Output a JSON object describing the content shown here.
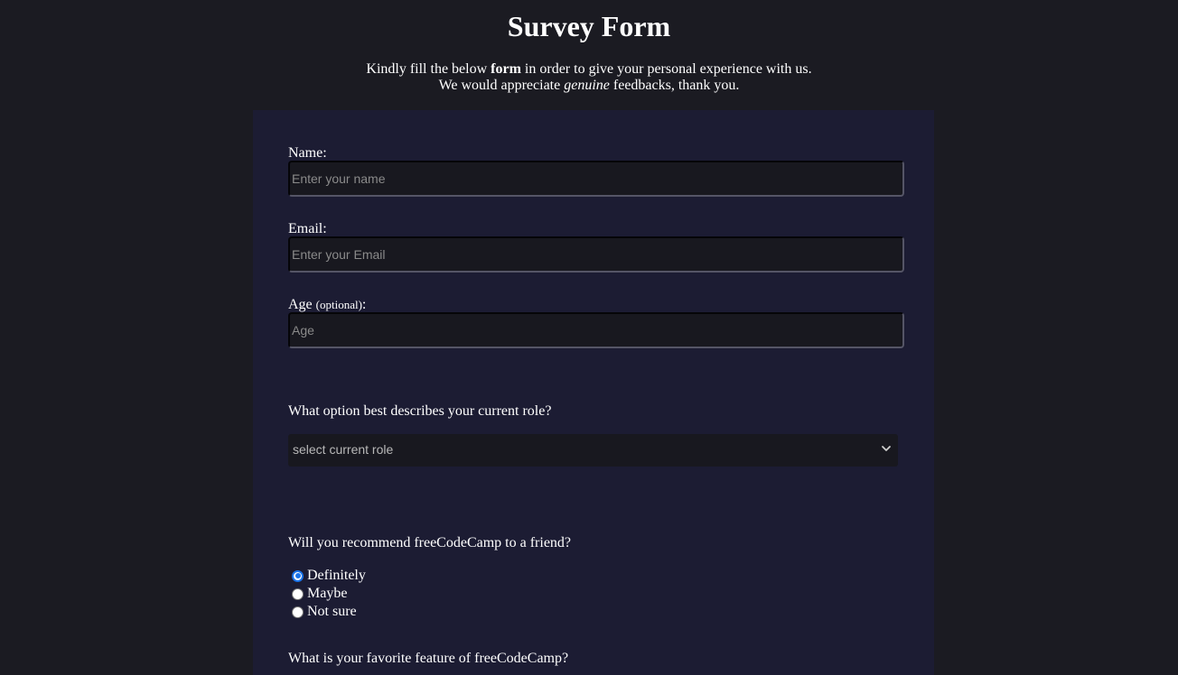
{
  "header": {
    "title": "Survey Form",
    "intro_line1_a": "Kindly fill the below ",
    "intro_line1_bold": "form",
    "intro_line1_b": " in order to give your personal experience with us.",
    "intro_line2_a": "We would appreciate ",
    "intro_line2_italic": "genuine",
    "intro_line2_b": " feedbacks, thank you."
  },
  "form": {
    "name": {
      "label": "Name:",
      "placeholder": "Enter your name",
      "value": ""
    },
    "email": {
      "label": "Email:",
      "placeholder": "Enter your Email",
      "value": ""
    },
    "age": {
      "label": "Age",
      "label_note": "(optional)",
      "label_suffix": ":",
      "placeholder": "Age",
      "value": ""
    },
    "role": {
      "question": "What option best describes your current role?",
      "selected": "select current role"
    },
    "recommend": {
      "question": "Will you recommend freeCodeCamp to a friend?",
      "options": [
        {
          "label": "Definitely",
          "checked": true
        },
        {
          "label": "Maybe",
          "checked": false
        },
        {
          "label": "Not sure",
          "checked": false
        }
      ]
    },
    "feature": {
      "question": "What is your favorite feature of freeCodeCamp?"
    }
  },
  "colors": {
    "background": "#1b1b22",
    "panel": "#1c1c33",
    "input_bg": "#18181f",
    "radio_accent": "#1a73e8"
  }
}
